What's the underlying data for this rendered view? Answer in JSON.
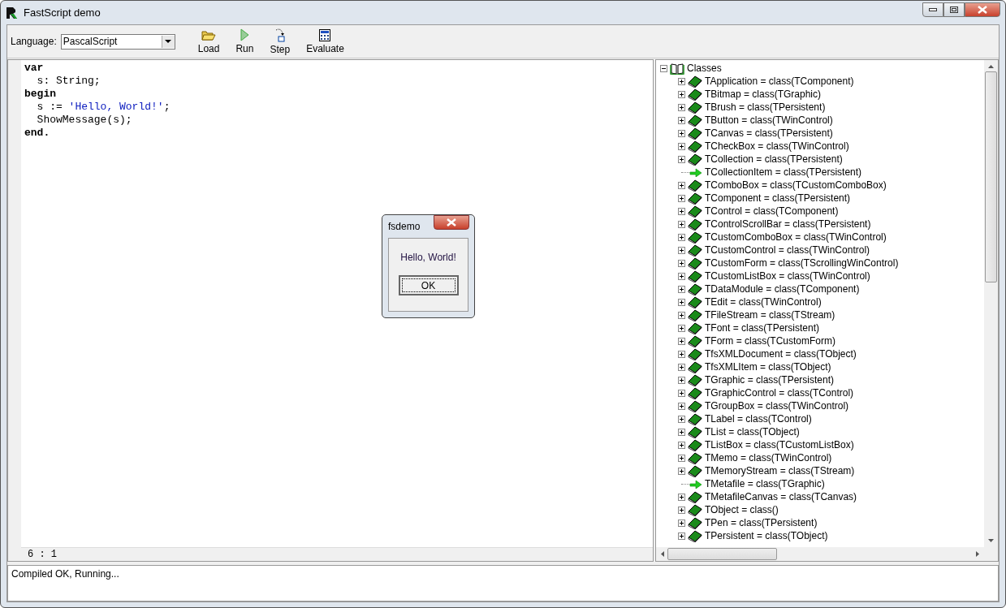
{
  "window": {
    "title": "FastScript demo"
  },
  "toolbar": {
    "language_label": "Language:",
    "language": "PascalScript",
    "buttons": [
      {
        "label": "Load",
        "kind": "load"
      },
      {
        "label": "Run",
        "kind": "run"
      },
      {
        "label": "Step",
        "kind": "step"
      },
      {
        "label": "Evaluate",
        "kind": "evaluate"
      }
    ]
  },
  "editor": {
    "lines": [
      [
        {
          "kind": "keyword",
          "text": "var"
        }
      ],
      [
        {
          "kind": "plain",
          "text": "  s: String;"
        }
      ],
      [
        {
          "kind": "keyword",
          "text": "begin"
        }
      ],
      [
        {
          "kind": "plain",
          "text": "  s := "
        },
        {
          "kind": "string",
          "text": "'Hello, World!'"
        },
        {
          "kind": "plain",
          "text": ";"
        }
      ],
      [
        {
          "kind": "plain",
          "text": "  ShowMessage(s);"
        }
      ],
      [
        {
          "kind": "keyword",
          "text": "end."
        }
      ]
    ],
    "cursor": "6 : 1"
  },
  "tree": {
    "label": "Classes",
    "expanded": true,
    "children": [
      {
        "label": "TApplication = class(TComponent)",
        "kind": "class"
      },
      {
        "label": "TBitmap = class(TGraphic)",
        "kind": "class"
      },
      {
        "label": "TBrush = class(TPersistent)",
        "kind": "class"
      },
      {
        "label": "TButton = class(TWinControl)",
        "kind": "class"
      },
      {
        "label": "TCanvas = class(TPersistent)",
        "kind": "class"
      },
      {
        "label": "TCheckBox = class(TWinControl)",
        "kind": "class"
      },
      {
        "label": "TCollection = class(TPersistent)",
        "kind": "class"
      },
      {
        "label": "TCollectionItem = class(TPersistent)",
        "kind": "leaf"
      },
      {
        "label": "TComboBox = class(TCustomComboBox)",
        "kind": "class"
      },
      {
        "label": "TComponent = class(TPersistent)",
        "kind": "class"
      },
      {
        "label": "TControl = class(TComponent)",
        "kind": "class"
      },
      {
        "label": "TControlScrollBar = class(TPersistent)",
        "kind": "class"
      },
      {
        "label": "TCustomComboBox = class(TWinControl)",
        "kind": "class"
      },
      {
        "label": "TCustomControl = class(TWinControl)",
        "kind": "class"
      },
      {
        "label": "TCustomForm = class(TScrollingWinControl)",
        "kind": "class"
      },
      {
        "label": "TCustomListBox = class(TWinControl)",
        "kind": "class"
      },
      {
        "label": "TDataModule = class(TComponent)",
        "kind": "class"
      },
      {
        "label": "TEdit = class(TWinControl)",
        "kind": "class"
      },
      {
        "label": "TFileStream = class(TStream)",
        "kind": "class"
      },
      {
        "label": "TFont = class(TPersistent)",
        "kind": "class"
      },
      {
        "label": "TForm = class(TCustomForm)",
        "kind": "class"
      },
      {
        "label": "TfsXMLDocument = class(TObject)",
        "kind": "class"
      },
      {
        "label": "TfsXMLItem = class(TObject)",
        "kind": "class"
      },
      {
        "label": "TGraphic = class(TPersistent)",
        "kind": "class"
      },
      {
        "label": "TGraphicControl = class(TControl)",
        "kind": "class"
      },
      {
        "label": "TGroupBox = class(TWinControl)",
        "kind": "class"
      },
      {
        "label": "TLabel = class(TControl)",
        "kind": "class"
      },
      {
        "label": "TList = class(TObject)",
        "kind": "class"
      },
      {
        "label": "TListBox = class(TCustomListBox)",
        "kind": "class"
      },
      {
        "label": "TMemo = class(TWinControl)",
        "kind": "class"
      },
      {
        "label": "TMemoryStream = class(TStream)",
        "kind": "class"
      },
      {
        "label": "TMetafile = class(TGraphic)",
        "kind": "leaf"
      },
      {
        "label": "TMetafileCanvas = class(TCanvas)",
        "kind": "class"
      },
      {
        "label": "TObject = class()",
        "kind": "class"
      },
      {
        "label": "TPen = class(TPersistent)",
        "kind": "class"
      },
      {
        "label": "TPersistent = class(TObject)",
        "kind": "class"
      }
    ]
  },
  "messages": [
    "Compiled OK, Running..."
  ],
  "dialog": {
    "title": "fsdemo",
    "message": "Hello, World!",
    "button": "OK"
  }
}
